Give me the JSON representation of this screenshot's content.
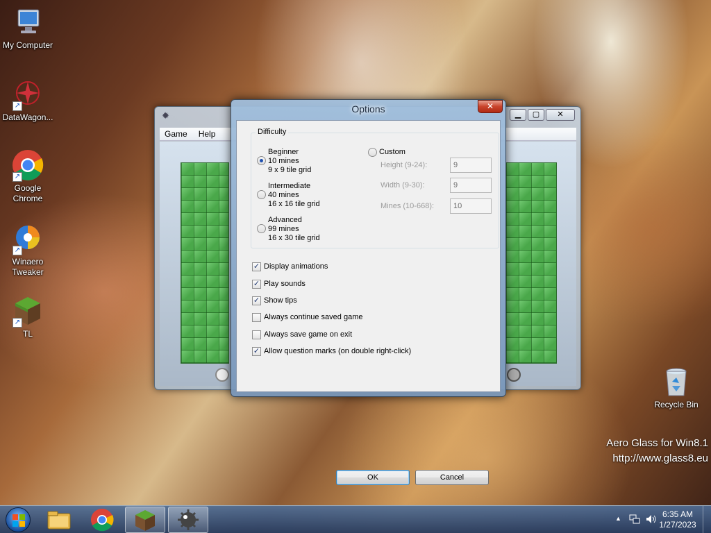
{
  "desktop": {
    "icons": [
      {
        "label": "My Computer"
      },
      {
        "label": "DataWagon..."
      },
      {
        "label": "Google Chrome"
      },
      {
        "label": "Winaero Tweaker"
      },
      {
        "label": "TL"
      },
      {
        "label": "Recycle Bin"
      }
    ],
    "watermark": {
      "line1": "Aero Glass for Win8.1",
      "line2": "http://www.glass8.eu"
    }
  },
  "minesweeper": {
    "menu": [
      "Game",
      "Help"
    ]
  },
  "dialog": {
    "title": "Options",
    "close_label": "✕",
    "difficulty": {
      "legend": "Difficulty",
      "beginner": {
        "name": "Beginner",
        "mines": "10 mines",
        "grid": "9 x 9 tile grid",
        "selected": true
      },
      "intermediate": {
        "name": "Intermediate",
        "mines": "40 mines",
        "grid": "16 x 16 tile grid",
        "selected": false
      },
      "advanced": {
        "name": "Advanced",
        "mines": "99 mines",
        "grid": "16 x 30 tile grid",
        "selected": false
      },
      "custom": {
        "name": "Custom",
        "selected": false,
        "height_label": "Height (9-24):",
        "height_value": "9",
        "width_label": "Width (9-30):",
        "width_value": "9",
        "mines_label": "Mines (10-668):",
        "mines_value": "10"
      }
    },
    "options": [
      {
        "label": "Display animations",
        "checked": true
      },
      {
        "label": "Play sounds",
        "checked": true
      },
      {
        "label": "Show tips",
        "checked": true
      },
      {
        "label": "Always continue saved game",
        "checked": false
      },
      {
        "label": "Always save game on exit",
        "checked": false
      },
      {
        "label": "Allow question marks (on double right-click)",
        "checked": true
      }
    ],
    "ok_label": "OK",
    "cancel_label": "Cancel"
  },
  "taskbar": {
    "clock_time": "6:35 AM",
    "clock_date": "1/27/2023",
    "tray_arrow": "▲",
    "apps": [
      "file-explorer-icon",
      "chrome-icon",
      "minecraft-icon",
      "minesweeper-icon"
    ]
  }
}
